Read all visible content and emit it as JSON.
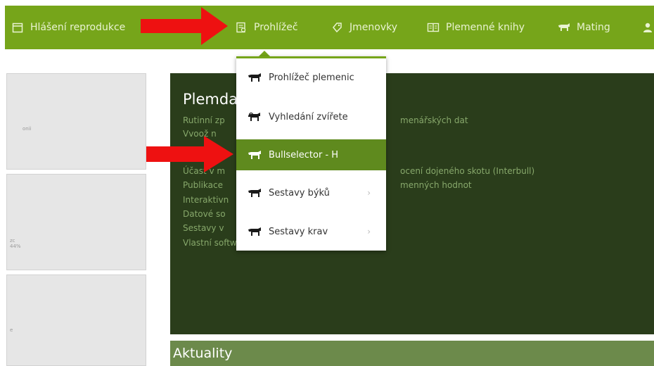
{
  "navbar": {
    "items": [
      {
        "label": "Hlášení reprodukce",
        "icon": "calendar-icon"
      },
      {
        "label": "Prohlížeč",
        "icon": "document-search-icon"
      },
      {
        "label": "Jmenovky",
        "icon": "tag-icon"
      },
      {
        "label": "Plemenné knihy",
        "icon": "book-icon"
      },
      {
        "label": "Mating",
        "icon": "cow-pair-icon"
      },
      {
        "label": "",
        "icon": "user-icon"
      }
    ]
  },
  "dropdown": {
    "items": [
      {
        "label": "Prohlížeč plemenic",
        "icon": "cow-icon",
        "submenu": false
      },
      {
        "label": "Vyhledání zvířete",
        "icon": "cow-search-icon",
        "submenu": false
      },
      {
        "label": "Bullselector - H",
        "icon": "bull-icon",
        "submenu": false,
        "active": true
      },
      {
        "label": "Sestavy býků",
        "icon": "bull-icon",
        "submenu": true
      },
      {
        "label": "Sestavy krav",
        "icon": "cow-icon",
        "submenu": true
      }
    ],
    "chevron": "›"
  },
  "main": {
    "title": "Plemda",
    "lines": [
      "Rutinní zp",
      "Vvoož n",
      "Účast v m",
      "Publikace",
      "Interaktivn",
      "Datové so",
      "Sestavy v",
      "Vlastní software"
    ],
    "lines_right": [
      "menářských dat",
      "ocení dojeného skotu (Interbull)",
      "menných hodnot"
    ]
  },
  "news": {
    "title": "Aktuality"
  },
  "left_cards": {
    "tiny1": "onii",
    "tiny2": "zc\n44%",
    "tiny3": "e"
  },
  "colors": {
    "nav": "#76a51a",
    "panel": "#2a3d1b",
    "news": "#6c8a4b",
    "active": "#5f8a1e",
    "arrow": "#ee1111"
  }
}
